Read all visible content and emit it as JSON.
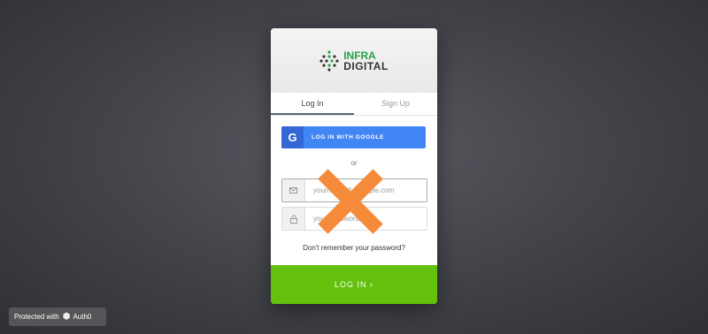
{
  "logo": {
    "line1": "INFRA",
    "line2": "DIGITAL"
  },
  "tabs": [
    {
      "label": "Log In",
      "active": true
    },
    {
      "label": "Sign Up",
      "active": false
    }
  ],
  "google_button": {
    "icon": "G",
    "label": "LOG IN WITH GOOGLE"
  },
  "separator": "or",
  "email_field": {
    "placeholder": "yourname@example.com",
    "icon": "email-icon"
  },
  "password_field": {
    "placeholder": "your password",
    "icon": "lock-icon"
  },
  "forgot_link": "Don't remember your password?",
  "submit_button": {
    "label": "LOG IN ›"
  },
  "badge": {
    "text": "Protected with",
    "brand": "Auth0"
  },
  "colors": {
    "submit": "#63c10d",
    "google": "#4285f4",
    "overlay_x": "#f58a3a",
    "logo_green": "#2aa14a"
  }
}
